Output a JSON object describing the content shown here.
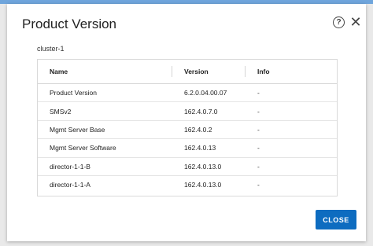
{
  "dialog": {
    "title": "Product Version",
    "help_icon": "help-circle-icon",
    "close_icon": "close-x-icon",
    "cluster_label": "cluster-1",
    "close_label": "CLOSE"
  },
  "table": {
    "headers": [
      "Name",
      "Version",
      "Info"
    ],
    "rows": [
      [
        "Product Version",
        "6.2.0.04.00.07",
        "-"
      ],
      [
        "SMSv2",
        "162.4.0.7.0",
        "-"
      ],
      [
        "Mgmt Server Base",
        "162.4.0.2",
        "-"
      ],
      [
        "Mgmt Server Software",
        "162.4.0.13",
        "-"
      ],
      [
        "director-1-1-B",
        "162.4.0.13.0",
        "-"
      ],
      [
        "director-1-1-A",
        "162.4.0.13.0",
        "-"
      ]
    ]
  },
  "colors": {
    "accent": "#0d6cc0",
    "top_bar": "#6fa5dc"
  }
}
